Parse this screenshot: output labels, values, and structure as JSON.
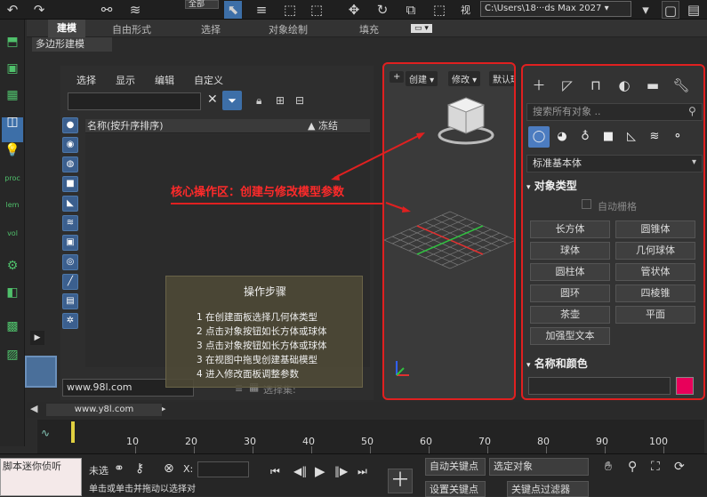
{
  "topbar": {
    "workspace": "全部",
    "path": "C:\\Users\\18···ds Max 2027 ▾",
    "view_label": "视"
  },
  "ribbon": {
    "tabs": [
      "建模",
      "自由形式",
      "选择",
      "对象绘制",
      "填充"
    ],
    "subtab": "多边形建模"
  },
  "left_strip": {
    "labels": [
      "proc",
      "lem",
      "vol"
    ]
  },
  "scene_explorer": {
    "menu": [
      "选择",
      "显示",
      "编辑",
      "自定义"
    ],
    "col_name": "名称(按升序排序)",
    "col_freeze": "▲ 冻结",
    "workspace_field": "www.98l.com",
    "selection_set": "选择集:"
  },
  "steps": {
    "title": "操作步骤",
    "items": [
      "1 在创建面板选择几何体类型",
      "2 点击对象按钮如长方体或球体",
      "3 点击对象按钮如长方体或球体",
      "3 在视图中拖曳创建基础模型",
      "4 进入修改面板调整参数"
    ]
  },
  "viewport": {
    "plus": "+",
    "create": "创建 ▾",
    "modify": "修改 ▾",
    "default": "默认球"
  },
  "annotation": "核心操作区：创建与修改模型参数",
  "command_panel": {
    "search_placeholder": "搜索所有对象 ..",
    "category": "标准基本体",
    "object_type_title": "对象类型",
    "autogrid": "自动栅格",
    "primitives": [
      "长方体",
      "圆锥体",
      "球体",
      "几何球体",
      "圆柱体",
      "管状体",
      "圆环",
      "四棱锥",
      "茶壶",
      "平面",
      "加强型文本"
    ],
    "name_color_title": "名称和颜色",
    "swatch_color": "#e8005a"
  },
  "status": {
    "frame_counter": "www.y8l.com"
  },
  "timeline": {
    "labels": [
      "10",
      "20",
      "30",
      "40",
      "50",
      "60",
      "70",
      "80",
      "90",
      "100"
    ]
  },
  "bottom": {
    "left_box": "脚本迷你侦听",
    "weiwei": "未选",
    "x_label": "X:",
    "auto_key": "自动关键点",
    "selected_obj": "选定对象",
    "set_key": "设置关键点",
    "key_filter": "关键点过滤器",
    "bottom_text": "单击或单击并拖动以选择对"
  }
}
